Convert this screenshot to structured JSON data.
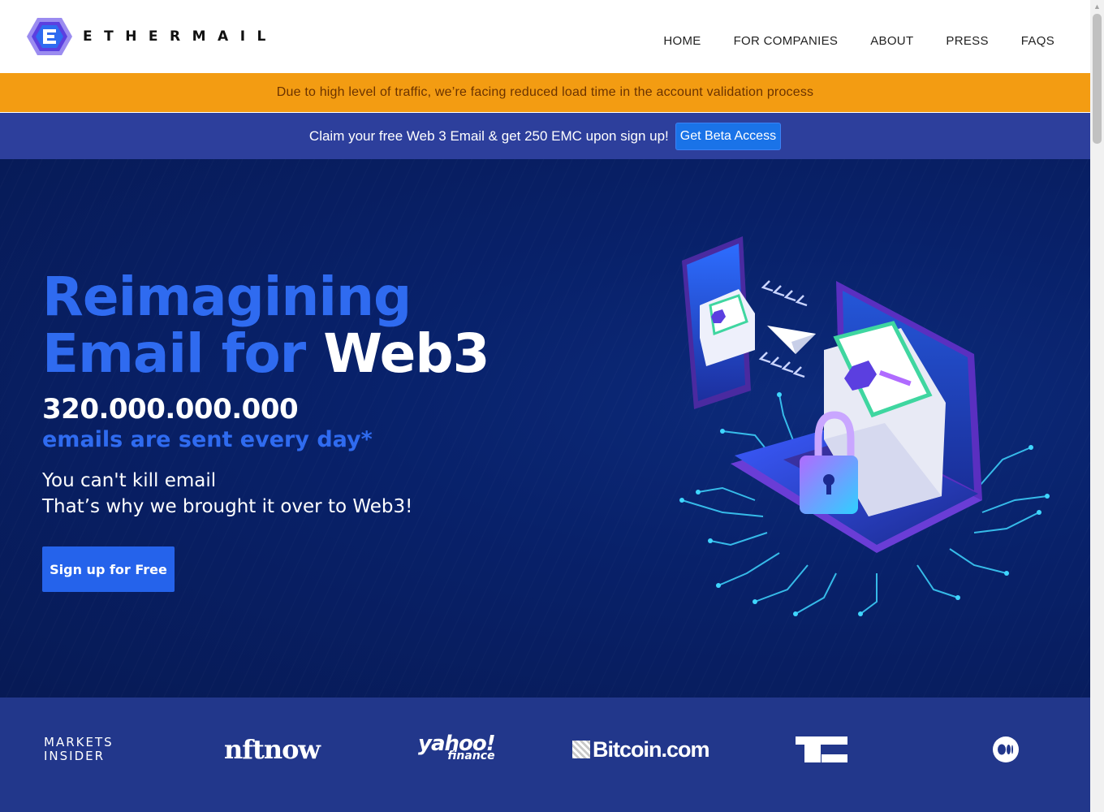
{
  "header": {
    "logo_text": "ETHERMAIL",
    "nav": [
      "HOME",
      "FOR COMPANIES",
      "ABOUT",
      "PRESS",
      "FAQS"
    ]
  },
  "notice": {
    "text": "Due to high level of traffic, we’re facing reduced load time in the account validation process"
  },
  "promo": {
    "text": "Claim your free Web 3 Email & get 250 EMC upon sign up!",
    "button_label": "Get Beta Access"
  },
  "hero": {
    "title_line1": "Reimagining",
    "title_line2_blue": "Email for ",
    "title_line2_white": "Web3",
    "big_number": "320.000.000.000",
    "sub_blue": "emails are sent every day*",
    "tagline_line1": "You can't kill email",
    "tagline_line2": "That’s why we brought it over to Web3!",
    "cta_label": "Sign up for Free"
  },
  "press": {
    "markets_line1": "MARKETS",
    "markets_line2": "INSIDER",
    "nftnow": "nftnow",
    "yahoo_line1": "yahoo!",
    "yahoo_line2": "finance",
    "bitcoin": "Bitcoin.com",
    "techcrunch_icon": "techcrunch-logo",
    "medium_icon": "medium-logo"
  },
  "colors": {
    "accent_blue": "#2f6bf0",
    "notice_orange": "#f39c12",
    "promo_bar": "#2d3f9c",
    "hero_bg": "#08216a",
    "press_bg": "#22378b"
  }
}
